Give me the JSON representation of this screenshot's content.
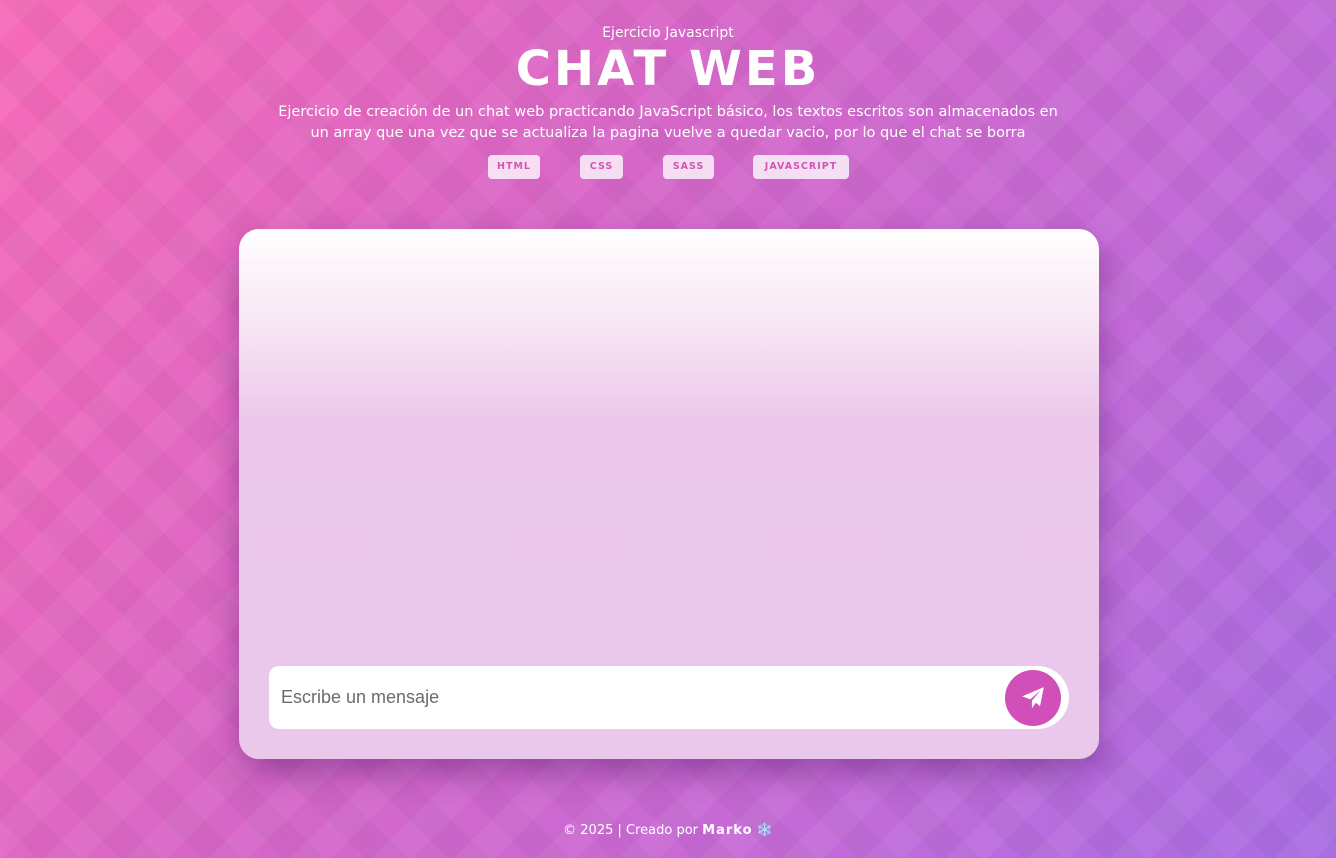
{
  "header": {
    "subtitle": "Ejercicio Javascript",
    "title": "CHAT WEB",
    "description": "Ejercicio de creación de un chat web practicando JavaScript básico, los textos escritos son almacenados en un array que una vez que se actualiza la pagina vuelve a quedar vacio, por lo que el chat se borra",
    "tags": [
      "HTML",
      "CSS",
      "SASS",
      "JAVASCRIPT"
    ]
  },
  "chat": {
    "input_placeholder": "Escribe un mensaje",
    "input_value": "",
    "send_icon": "paper-plane-icon"
  },
  "footer": {
    "copyright": "© 2025 | Creado por",
    "author": "Marko",
    "emoji": "❄️"
  },
  "colors": {
    "accent": "#d14fb8",
    "tag_text": "#d454b4",
    "background_start": "#f76ab8",
    "background_end": "#a86ee4"
  }
}
